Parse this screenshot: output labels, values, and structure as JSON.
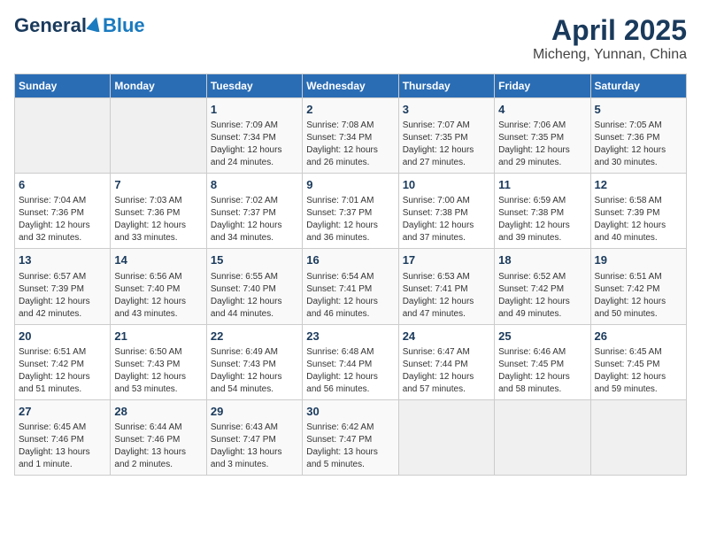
{
  "header": {
    "logo_general": "General",
    "logo_blue": "Blue",
    "title": "April 2025",
    "subtitle": "Micheng, Yunnan, China"
  },
  "calendar": {
    "days_of_week": [
      "Sunday",
      "Monday",
      "Tuesday",
      "Wednesday",
      "Thursday",
      "Friday",
      "Saturday"
    ],
    "weeks": [
      [
        {
          "day": "",
          "info": ""
        },
        {
          "day": "",
          "info": ""
        },
        {
          "day": "1",
          "info": "Sunrise: 7:09 AM\nSunset: 7:34 PM\nDaylight: 12 hours\nand 24 minutes."
        },
        {
          "day": "2",
          "info": "Sunrise: 7:08 AM\nSunset: 7:34 PM\nDaylight: 12 hours\nand 26 minutes."
        },
        {
          "day": "3",
          "info": "Sunrise: 7:07 AM\nSunset: 7:35 PM\nDaylight: 12 hours\nand 27 minutes."
        },
        {
          "day": "4",
          "info": "Sunrise: 7:06 AM\nSunset: 7:35 PM\nDaylight: 12 hours\nand 29 minutes."
        },
        {
          "day": "5",
          "info": "Sunrise: 7:05 AM\nSunset: 7:36 PM\nDaylight: 12 hours\nand 30 minutes."
        }
      ],
      [
        {
          "day": "6",
          "info": "Sunrise: 7:04 AM\nSunset: 7:36 PM\nDaylight: 12 hours\nand 32 minutes."
        },
        {
          "day": "7",
          "info": "Sunrise: 7:03 AM\nSunset: 7:36 PM\nDaylight: 12 hours\nand 33 minutes."
        },
        {
          "day": "8",
          "info": "Sunrise: 7:02 AM\nSunset: 7:37 PM\nDaylight: 12 hours\nand 34 minutes."
        },
        {
          "day": "9",
          "info": "Sunrise: 7:01 AM\nSunset: 7:37 PM\nDaylight: 12 hours\nand 36 minutes."
        },
        {
          "day": "10",
          "info": "Sunrise: 7:00 AM\nSunset: 7:38 PM\nDaylight: 12 hours\nand 37 minutes."
        },
        {
          "day": "11",
          "info": "Sunrise: 6:59 AM\nSunset: 7:38 PM\nDaylight: 12 hours\nand 39 minutes."
        },
        {
          "day": "12",
          "info": "Sunrise: 6:58 AM\nSunset: 7:39 PM\nDaylight: 12 hours\nand 40 minutes."
        }
      ],
      [
        {
          "day": "13",
          "info": "Sunrise: 6:57 AM\nSunset: 7:39 PM\nDaylight: 12 hours\nand 42 minutes."
        },
        {
          "day": "14",
          "info": "Sunrise: 6:56 AM\nSunset: 7:40 PM\nDaylight: 12 hours\nand 43 minutes."
        },
        {
          "day": "15",
          "info": "Sunrise: 6:55 AM\nSunset: 7:40 PM\nDaylight: 12 hours\nand 44 minutes."
        },
        {
          "day": "16",
          "info": "Sunrise: 6:54 AM\nSunset: 7:41 PM\nDaylight: 12 hours\nand 46 minutes."
        },
        {
          "day": "17",
          "info": "Sunrise: 6:53 AM\nSunset: 7:41 PM\nDaylight: 12 hours\nand 47 minutes."
        },
        {
          "day": "18",
          "info": "Sunrise: 6:52 AM\nSunset: 7:42 PM\nDaylight: 12 hours\nand 49 minutes."
        },
        {
          "day": "19",
          "info": "Sunrise: 6:51 AM\nSunset: 7:42 PM\nDaylight: 12 hours\nand 50 minutes."
        }
      ],
      [
        {
          "day": "20",
          "info": "Sunrise: 6:51 AM\nSunset: 7:42 PM\nDaylight: 12 hours\nand 51 minutes."
        },
        {
          "day": "21",
          "info": "Sunrise: 6:50 AM\nSunset: 7:43 PM\nDaylight: 12 hours\nand 53 minutes."
        },
        {
          "day": "22",
          "info": "Sunrise: 6:49 AM\nSunset: 7:43 PM\nDaylight: 12 hours\nand 54 minutes."
        },
        {
          "day": "23",
          "info": "Sunrise: 6:48 AM\nSunset: 7:44 PM\nDaylight: 12 hours\nand 56 minutes."
        },
        {
          "day": "24",
          "info": "Sunrise: 6:47 AM\nSunset: 7:44 PM\nDaylight: 12 hours\nand 57 minutes."
        },
        {
          "day": "25",
          "info": "Sunrise: 6:46 AM\nSunset: 7:45 PM\nDaylight: 12 hours\nand 58 minutes."
        },
        {
          "day": "26",
          "info": "Sunrise: 6:45 AM\nSunset: 7:45 PM\nDaylight: 12 hours\nand 59 minutes."
        }
      ],
      [
        {
          "day": "27",
          "info": "Sunrise: 6:45 AM\nSunset: 7:46 PM\nDaylight: 13 hours\nand 1 minute."
        },
        {
          "day": "28",
          "info": "Sunrise: 6:44 AM\nSunset: 7:46 PM\nDaylight: 13 hours\nand 2 minutes."
        },
        {
          "day": "29",
          "info": "Sunrise: 6:43 AM\nSunset: 7:47 PM\nDaylight: 13 hours\nand 3 minutes."
        },
        {
          "day": "30",
          "info": "Sunrise: 6:42 AM\nSunset: 7:47 PM\nDaylight: 13 hours\nand 5 minutes."
        },
        {
          "day": "",
          "info": ""
        },
        {
          "day": "",
          "info": ""
        },
        {
          "day": "",
          "info": ""
        }
      ]
    ]
  }
}
